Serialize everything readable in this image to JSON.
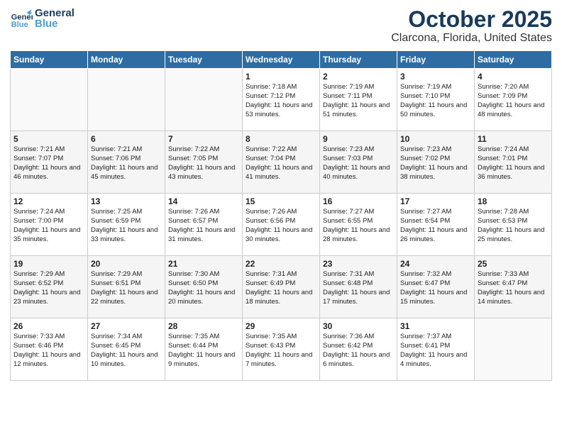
{
  "header": {
    "logo_general": "General",
    "logo_blue": "Blue",
    "month": "October 2025",
    "location": "Clarcona, Florida, United States"
  },
  "weekdays": [
    "Sunday",
    "Monday",
    "Tuesday",
    "Wednesday",
    "Thursday",
    "Friday",
    "Saturday"
  ],
  "weeks": [
    [
      {
        "day": "",
        "sunrise": "",
        "sunset": "",
        "daylight": ""
      },
      {
        "day": "",
        "sunrise": "",
        "sunset": "",
        "daylight": ""
      },
      {
        "day": "",
        "sunrise": "",
        "sunset": "",
        "daylight": ""
      },
      {
        "day": "1",
        "sunrise": "Sunrise: 7:18 AM",
        "sunset": "Sunset: 7:12 PM",
        "daylight": "Daylight: 11 hours and 53 minutes."
      },
      {
        "day": "2",
        "sunrise": "Sunrise: 7:19 AM",
        "sunset": "Sunset: 7:11 PM",
        "daylight": "Daylight: 11 hours and 51 minutes."
      },
      {
        "day": "3",
        "sunrise": "Sunrise: 7:19 AM",
        "sunset": "Sunset: 7:10 PM",
        "daylight": "Daylight: 11 hours and 50 minutes."
      },
      {
        "day": "4",
        "sunrise": "Sunrise: 7:20 AM",
        "sunset": "Sunset: 7:09 PM",
        "daylight": "Daylight: 11 hours and 48 minutes."
      }
    ],
    [
      {
        "day": "5",
        "sunrise": "Sunrise: 7:21 AM",
        "sunset": "Sunset: 7:07 PM",
        "daylight": "Daylight: 11 hours and 46 minutes."
      },
      {
        "day": "6",
        "sunrise": "Sunrise: 7:21 AM",
        "sunset": "Sunset: 7:06 PM",
        "daylight": "Daylight: 11 hours and 45 minutes."
      },
      {
        "day": "7",
        "sunrise": "Sunrise: 7:22 AM",
        "sunset": "Sunset: 7:05 PM",
        "daylight": "Daylight: 11 hours and 43 minutes."
      },
      {
        "day": "8",
        "sunrise": "Sunrise: 7:22 AM",
        "sunset": "Sunset: 7:04 PM",
        "daylight": "Daylight: 11 hours and 41 minutes."
      },
      {
        "day": "9",
        "sunrise": "Sunrise: 7:23 AM",
        "sunset": "Sunset: 7:03 PM",
        "daylight": "Daylight: 11 hours and 40 minutes."
      },
      {
        "day": "10",
        "sunrise": "Sunrise: 7:23 AM",
        "sunset": "Sunset: 7:02 PM",
        "daylight": "Daylight: 11 hours and 38 minutes."
      },
      {
        "day": "11",
        "sunrise": "Sunrise: 7:24 AM",
        "sunset": "Sunset: 7:01 PM",
        "daylight": "Daylight: 11 hours and 36 minutes."
      }
    ],
    [
      {
        "day": "12",
        "sunrise": "Sunrise: 7:24 AM",
        "sunset": "Sunset: 7:00 PM",
        "daylight": "Daylight: 11 hours and 35 minutes."
      },
      {
        "day": "13",
        "sunrise": "Sunrise: 7:25 AM",
        "sunset": "Sunset: 6:59 PM",
        "daylight": "Daylight: 11 hours and 33 minutes."
      },
      {
        "day": "14",
        "sunrise": "Sunrise: 7:26 AM",
        "sunset": "Sunset: 6:57 PM",
        "daylight": "Daylight: 11 hours and 31 minutes."
      },
      {
        "day": "15",
        "sunrise": "Sunrise: 7:26 AM",
        "sunset": "Sunset: 6:56 PM",
        "daylight": "Daylight: 11 hours and 30 minutes."
      },
      {
        "day": "16",
        "sunrise": "Sunrise: 7:27 AM",
        "sunset": "Sunset: 6:55 PM",
        "daylight": "Daylight: 11 hours and 28 minutes."
      },
      {
        "day": "17",
        "sunrise": "Sunrise: 7:27 AM",
        "sunset": "Sunset: 6:54 PM",
        "daylight": "Daylight: 11 hours and 26 minutes."
      },
      {
        "day": "18",
        "sunrise": "Sunrise: 7:28 AM",
        "sunset": "Sunset: 6:53 PM",
        "daylight": "Daylight: 11 hours and 25 minutes."
      }
    ],
    [
      {
        "day": "19",
        "sunrise": "Sunrise: 7:29 AM",
        "sunset": "Sunset: 6:52 PM",
        "daylight": "Daylight: 11 hours and 23 minutes."
      },
      {
        "day": "20",
        "sunrise": "Sunrise: 7:29 AM",
        "sunset": "Sunset: 6:51 PM",
        "daylight": "Daylight: 11 hours and 22 minutes."
      },
      {
        "day": "21",
        "sunrise": "Sunrise: 7:30 AM",
        "sunset": "Sunset: 6:50 PM",
        "daylight": "Daylight: 11 hours and 20 minutes."
      },
      {
        "day": "22",
        "sunrise": "Sunrise: 7:31 AM",
        "sunset": "Sunset: 6:49 PM",
        "daylight": "Daylight: 11 hours and 18 minutes."
      },
      {
        "day": "23",
        "sunrise": "Sunrise: 7:31 AM",
        "sunset": "Sunset: 6:48 PM",
        "daylight": "Daylight: 11 hours and 17 minutes."
      },
      {
        "day": "24",
        "sunrise": "Sunrise: 7:32 AM",
        "sunset": "Sunset: 6:47 PM",
        "daylight": "Daylight: 11 hours and 15 minutes."
      },
      {
        "day": "25",
        "sunrise": "Sunrise: 7:33 AM",
        "sunset": "Sunset: 6:47 PM",
        "daylight": "Daylight: 11 hours and 14 minutes."
      }
    ],
    [
      {
        "day": "26",
        "sunrise": "Sunrise: 7:33 AM",
        "sunset": "Sunset: 6:46 PM",
        "daylight": "Daylight: 11 hours and 12 minutes."
      },
      {
        "day": "27",
        "sunrise": "Sunrise: 7:34 AM",
        "sunset": "Sunset: 6:45 PM",
        "daylight": "Daylight: 11 hours and 10 minutes."
      },
      {
        "day": "28",
        "sunrise": "Sunrise: 7:35 AM",
        "sunset": "Sunset: 6:44 PM",
        "daylight": "Daylight: 11 hours and 9 minutes."
      },
      {
        "day": "29",
        "sunrise": "Sunrise: 7:35 AM",
        "sunset": "Sunset: 6:43 PM",
        "daylight": "Daylight: 11 hours and 7 minutes."
      },
      {
        "day": "30",
        "sunrise": "Sunrise: 7:36 AM",
        "sunset": "Sunset: 6:42 PM",
        "daylight": "Daylight: 11 hours and 6 minutes."
      },
      {
        "day": "31",
        "sunrise": "Sunrise: 7:37 AM",
        "sunset": "Sunset: 6:41 PM",
        "daylight": "Daylight: 11 hours and 4 minutes."
      },
      {
        "day": "",
        "sunrise": "",
        "sunset": "",
        "daylight": ""
      }
    ]
  ]
}
